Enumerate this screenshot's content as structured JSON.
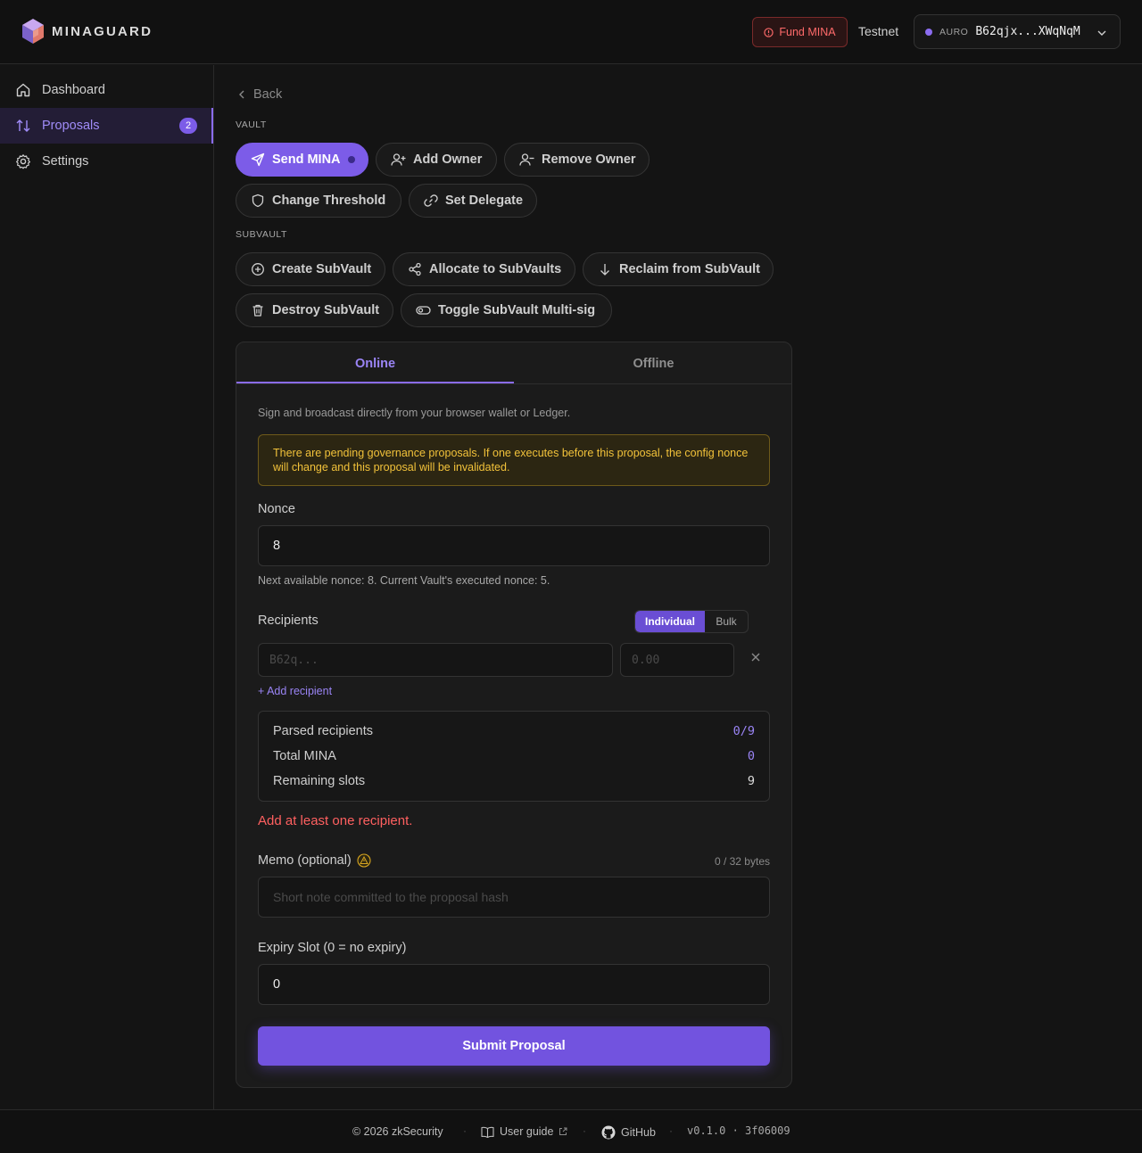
{
  "header": {
    "brand": "MINAGUARD",
    "fund_label": "Fund MINA",
    "network": "Testnet",
    "wallet_provider": "AURO",
    "wallet_address": "B62qjx...XWqNqM"
  },
  "sidebar": {
    "items": [
      {
        "label": "Dashboard",
        "icon": "home-icon"
      },
      {
        "label": "Proposals",
        "icon": "arrows-icon",
        "badge": "2"
      },
      {
        "label": "Settings",
        "icon": "gear-icon"
      }
    ]
  },
  "main": {
    "back_label": "Back",
    "vault_label": "VAULT",
    "vault_actions": [
      {
        "label": "Send MINA",
        "icon": "send-icon"
      },
      {
        "label": "Add Owner",
        "icon": "user-plus-icon"
      },
      {
        "label": "Remove Owner",
        "icon": "user-minus-icon"
      },
      {
        "label": "Change Threshold",
        "icon": "shield-icon"
      },
      {
        "label": "Set Delegate",
        "icon": "link-icon"
      }
    ],
    "subvault_label": "SUBVAULT",
    "subvault_actions": [
      {
        "label": "Create SubVault",
        "icon": "plus-circle-icon"
      },
      {
        "label": "Allocate to SubVaults",
        "icon": "share-icon"
      },
      {
        "label": "Reclaim from SubVault",
        "icon": "arrow-down-icon"
      },
      {
        "label": "Destroy SubVault",
        "icon": "trash-icon"
      },
      {
        "label": "Toggle SubVault Multi-sig",
        "icon": "toggle-icon"
      }
    ]
  },
  "form": {
    "tabs": [
      "Online",
      "Offline"
    ],
    "active_tab": "Online",
    "description": "Sign and broadcast directly from your browser wallet or Ledger.",
    "warning": "There are pending governance proposals. If one executes before this proposal, the config nonce will change and this proposal will be invalidated.",
    "nonce_label": "Nonce",
    "nonce_value": "8",
    "nonce_hint": "Next available nonce: 8. Current Vault's executed nonce: 5.",
    "recipients_label": "Recipients",
    "mode_options": [
      "Individual",
      "Bulk"
    ],
    "mode_selected": "Individual",
    "address_placeholder": "B62q...",
    "amount_placeholder": "0.00",
    "add_recipient_label": "+ Add recipient",
    "summary": [
      {
        "label": "Parsed recipients",
        "value": "0/9",
        "color": "#9a84f5"
      },
      {
        "label": "Total MINA",
        "value": "0",
        "color": "#9a84f5"
      },
      {
        "label": "Remaining slots",
        "value": "9",
        "color": "#dcdcdc"
      }
    ],
    "error": "Add at least one recipient.",
    "memo_label": "Memo (optional)",
    "memo_counter": "0 / 32 bytes",
    "memo_placeholder": "Short note committed to the proposal hash",
    "expiry_label": "Expiry Slot (0 = no expiry)",
    "expiry_value": "0",
    "submit_label": "Submit Proposal"
  },
  "footer": {
    "copyright": "© 2026 zkSecurity",
    "user_guide": "User guide",
    "github": "GitHub",
    "version": "v0.1.0 · 3f06009"
  },
  "colors": {
    "accent": "#7c5ce8",
    "warning": "#f2c23a",
    "error": "#ff6060"
  }
}
